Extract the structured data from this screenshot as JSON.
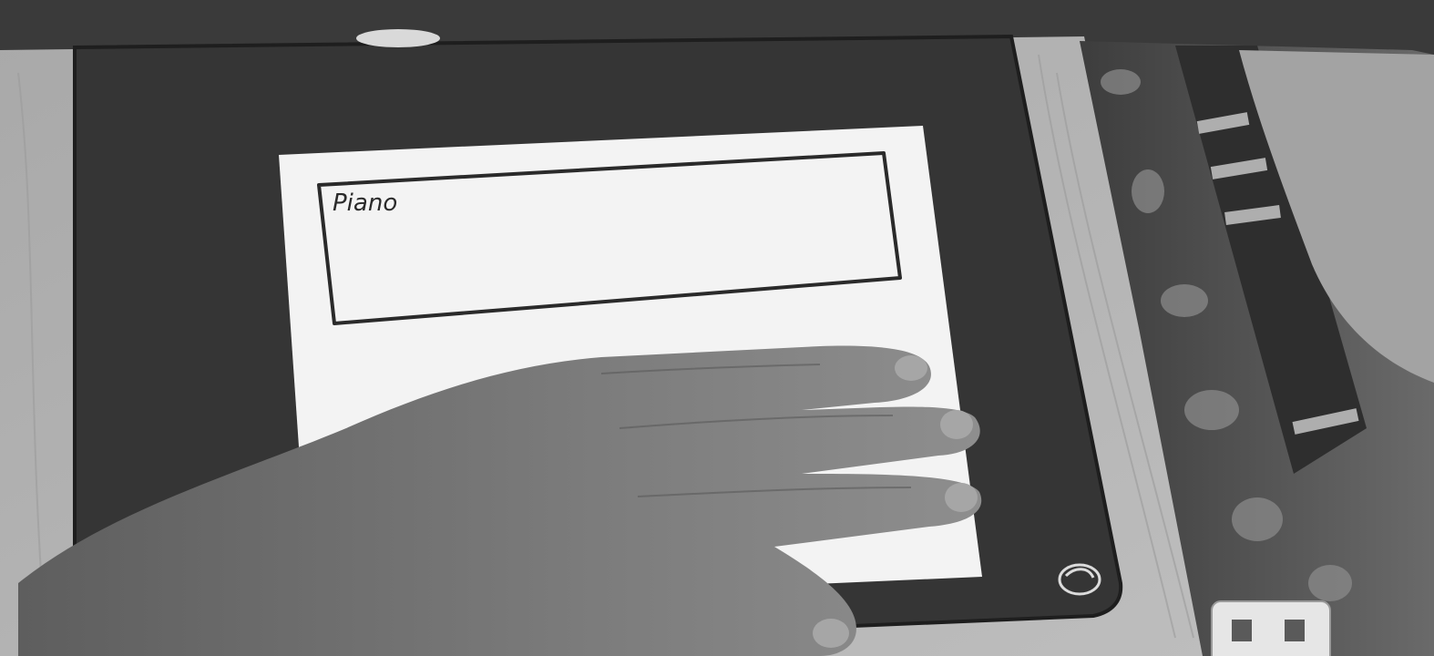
{
  "paper": {
    "label_text": "Piano"
  },
  "colors": {
    "background_strip": "#3a3a3a",
    "desk": "#b3b3b3",
    "tablet": "#353535",
    "paper": "#f3f3f3",
    "ink": "#2a2a2a",
    "hand": "#7a7a7a",
    "fabric": "#4a4a4a"
  }
}
